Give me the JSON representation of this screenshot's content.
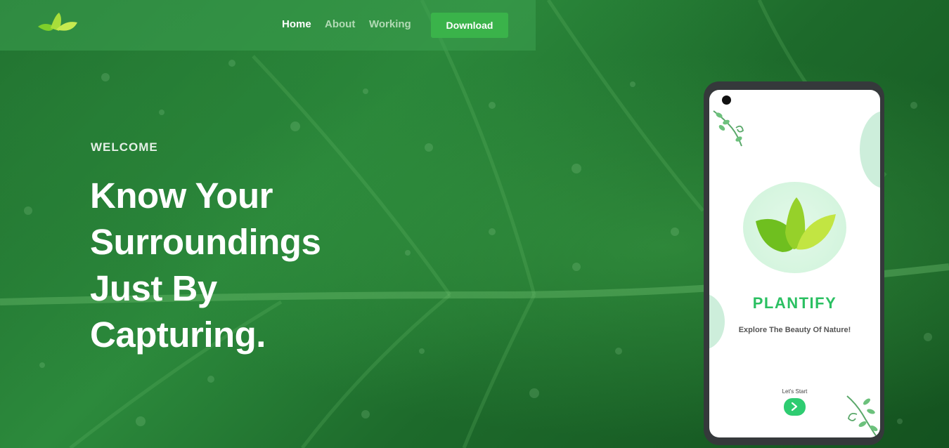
{
  "nav": {
    "links": [
      {
        "label": "Home",
        "active": true
      },
      {
        "label": "About",
        "active": false
      },
      {
        "label": "Working",
        "active": false
      }
    ],
    "download_label": "Download"
  },
  "hero": {
    "welcome": "WELCOME",
    "headline_lines": [
      "Know Your",
      "Surroundings",
      "Just By",
      "Capturing."
    ]
  },
  "phone_app": {
    "title": "PLANTIFY",
    "subtitle": "Explore The Beauty Of Nature!",
    "start_label": "Let's Start",
    "start_icon": "chevron-right-icon"
  },
  "colors": {
    "accent": "#3ab34a",
    "app_green": "#2ecc71",
    "leaf_dark": "#6fbf1f",
    "leaf_light": "#b8e23a"
  }
}
